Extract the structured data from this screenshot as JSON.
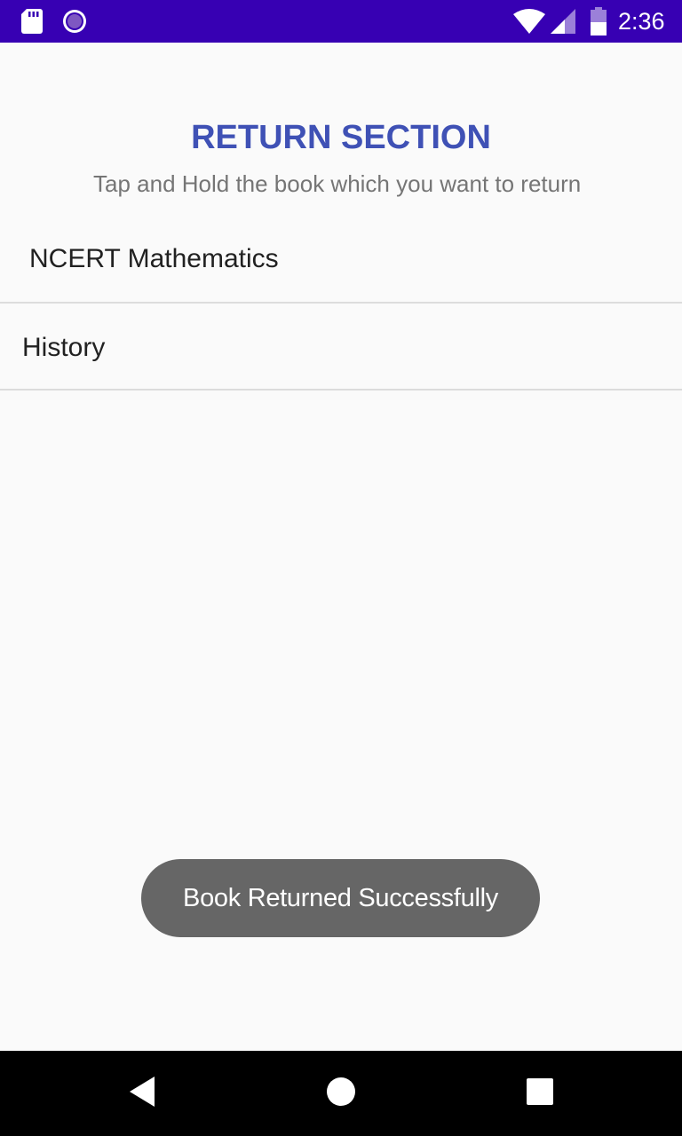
{
  "status_bar": {
    "time": "2:36",
    "left_icons": [
      "sd-card-icon",
      "record-icon"
    ],
    "right_icons": [
      "wifi-icon",
      "signal-icon",
      "battery-icon"
    ],
    "background_color": "#3700b3"
  },
  "page": {
    "title": "RETURN SECTION",
    "subtitle": "Tap and Hold the book which you want to return",
    "title_color": "#3f51b5"
  },
  "books": [
    {
      "label": "NCERT Mathematics"
    },
    {
      "label": "History"
    }
  ],
  "toast": {
    "message": "Book Returned Successfully"
  },
  "nav_bar": {
    "buttons": [
      "back-icon",
      "home-icon",
      "recents-icon"
    ]
  }
}
